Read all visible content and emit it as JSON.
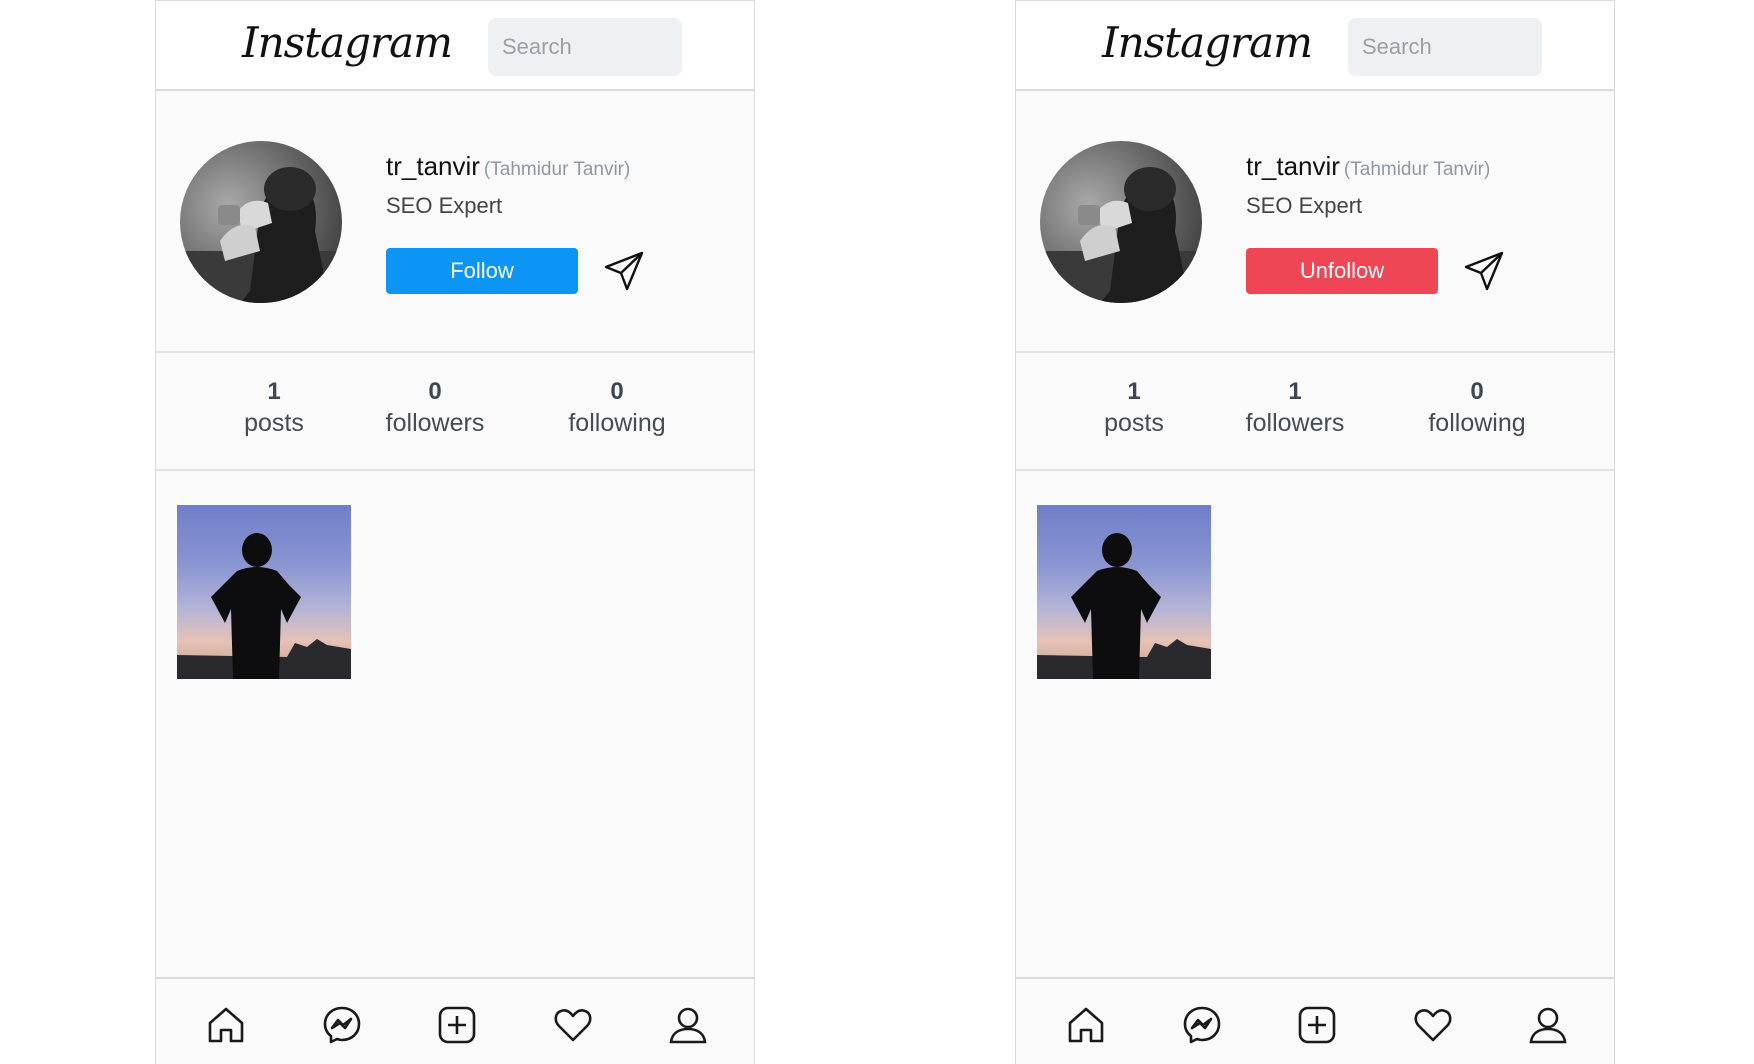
{
  "panels": [
    {
      "header": {
        "logo": "Instagram",
        "search_placeholder": "Search"
      },
      "profile": {
        "username": "tr_tanvir",
        "full_name": "(Tahmidur Tanvir)",
        "bio": "SEO Expert",
        "action_label": "Follow",
        "action_color": "#0d95f6"
      },
      "stats": [
        {
          "value": "1",
          "label": "posts"
        },
        {
          "value": "0",
          "label": "followers"
        },
        {
          "value": "0",
          "label": "following"
        }
      ],
      "nav": [
        "home-icon",
        "messenger-icon",
        "add-post-icon",
        "heart-icon",
        "profile-icon"
      ]
    },
    {
      "header": {
        "logo": "Instagram",
        "search_placeholder": "Search"
      },
      "profile": {
        "username": "tr_tanvir",
        "full_name": "(Tahmidur Tanvir)",
        "bio": "SEO Expert",
        "action_label": "Unfollow",
        "action_color": "#ee4655"
      },
      "stats": [
        {
          "value": "1",
          "label": "posts"
        },
        {
          "value": "1",
          "label": "followers"
        },
        {
          "value": "0",
          "label": "following"
        }
      ],
      "nav": [
        "home-icon",
        "messenger-icon",
        "add-post-icon",
        "heart-icon",
        "profile-icon"
      ]
    }
  ]
}
